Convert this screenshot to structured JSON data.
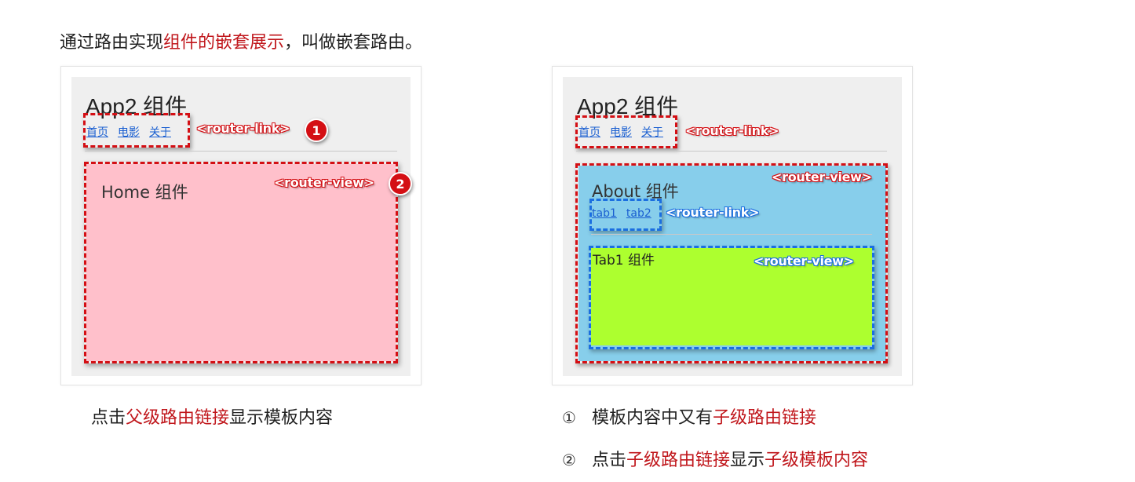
{
  "intro": {
    "before": "通过路由实现",
    "highlight": "组件的嵌套展示",
    "after": "，叫做嵌套路由。"
  },
  "left": {
    "app_title": "App2 组件",
    "links": [
      "首页",
      "电影",
      "关于"
    ],
    "link_tag": "<router-link>",
    "link_badge": "1",
    "view_tag": "<router-view>",
    "view_badge": "2",
    "component_title": "Home 组件",
    "caption_before": "点击",
    "caption_highlight": "父级路由链接",
    "caption_after": "显示模板内容"
  },
  "right": {
    "app_title": "App2 组件",
    "links": [
      "首页",
      "电影",
      "关于"
    ],
    "link_tag": "<router-link>",
    "view_tag": "<router-view>",
    "about_title": "About 组件",
    "sub_links": [
      "tab1",
      "tab2"
    ],
    "sub_link_tag": "<router-link>",
    "tab_title": "Tab1 组件",
    "sub_view_tag": "<router-view>",
    "bullets": [
      {
        "mark": "①",
        "before": "模板内容中又有",
        "highlight": "子级路由链接",
        "after": ""
      },
      {
        "mark": "②",
        "before": "点击",
        "highlight": "子级路由链接",
        "after": "显示",
        "highlight2": "子级模板内容"
      }
    ]
  },
  "colors": {
    "accent_red": "#c0161b",
    "home_bg": "#ffc0cb",
    "about_bg": "#87ceeb",
    "tab_bg": "#adff2f",
    "link_blue": "#1a5fd1"
  }
}
